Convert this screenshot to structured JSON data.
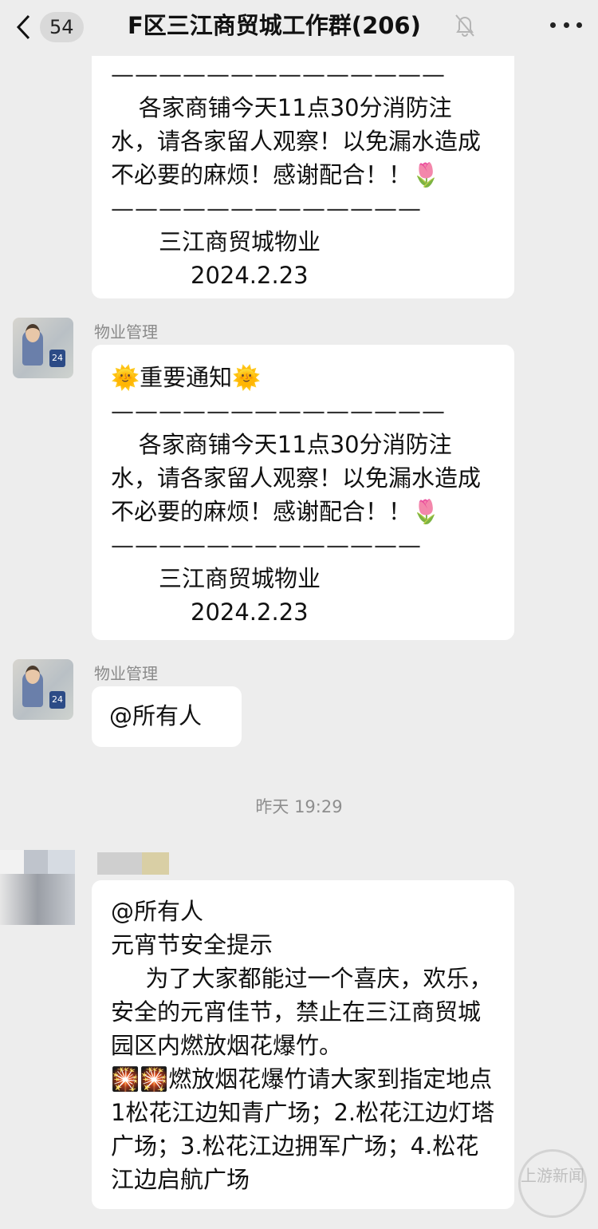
{
  "header": {
    "badge": "54",
    "title": "F区三江商贸城工作群(206)"
  },
  "messages": [
    {
      "dash1": "——————————————",
      "body": "各家商铺今天11点30分消防注水，请各家留人观察！以免漏水造成不必要的麻烦！感谢配合！！🌷",
      "dash2": "—————————————",
      "sig1": "三江商贸城物业",
      "sig2": "2024.2.23"
    },
    {
      "sender": "物业管理",
      "heading": "🌞重要通知🌞",
      "dash1": "——————————————",
      "body": "各家商铺今天11点30分消防注水，请各家留人观察！以免漏水造成不必要的麻烦！感谢配合！！🌷",
      "dash2": "—————————————",
      "sig1": "三江商贸城物业",
      "sig2": "2024.2.23"
    },
    {
      "sender": "物业管理",
      "text": "@所有人"
    }
  ],
  "timestamp": "昨天 19:29",
  "last_message": {
    "line1": "@所有人",
    "line2": "元宵节安全提示",
    "para1": "为了大家都能过一个喜庆，欢乐，安全的元宵佳节，禁止在三江商贸城园区内燃放烟花爆竹。",
    "para2": "🎇🎇燃放烟花爆竹请大家到指定地点1松花江边知青广场；2.松花江边灯塔广场；3.松花江边拥军广场；4.松花江边启航广场"
  },
  "watermark": "上游新闻"
}
